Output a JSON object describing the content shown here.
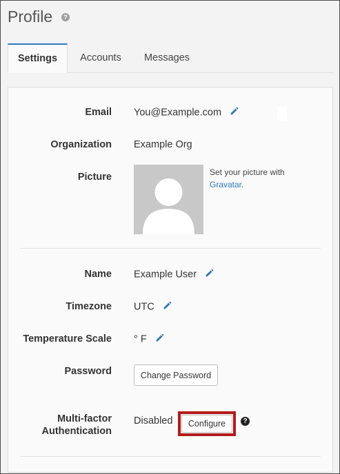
{
  "page": {
    "title": "Profile"
  },
  "tabs": [
    {
      "label": "Settings",
      "active": true
    },
    {
      "label": "Accounts",
      "active": false
    },
    {
      "label": "Messages",
      "active": false
    }
  ],
  "profile": {
    "email": {
      "label": "Email",
      "value": "You@Example.com"
    },
    "organization": {
      "label": "Organization",
      "value": "Example Org"
    },
    "picture": {
      "label": "Picture",
      "note_prefix": "Set your picture with ",
      "note_link": "Gravatar",
      "note_suffix": "."
    },
    "name": {
      "label": "Name",
      "value": "Example User"
    },
    "timezone": {
      "label": "Timezone",
      "value": "UTC"
    },
    "temperature": {
      "label": "Temperature Scale",
      "value": "° F"
    },
    "password": {
      "label": "Password",
      "button": "Change Password"
    },
    "mfa": {
      "label_line1": "Multi-factor",
      "label_line2": "Authentication",
      "status": "Disabled",
      "button": "Configure"
    }
  },
  "colors": {
    "accent": "#2e77bc",
    "highlight": "#b41a1a"
  },
  "icons": {
    "help": "question-circle-icon",
    "edit": "pencil-icon"
  }
}
